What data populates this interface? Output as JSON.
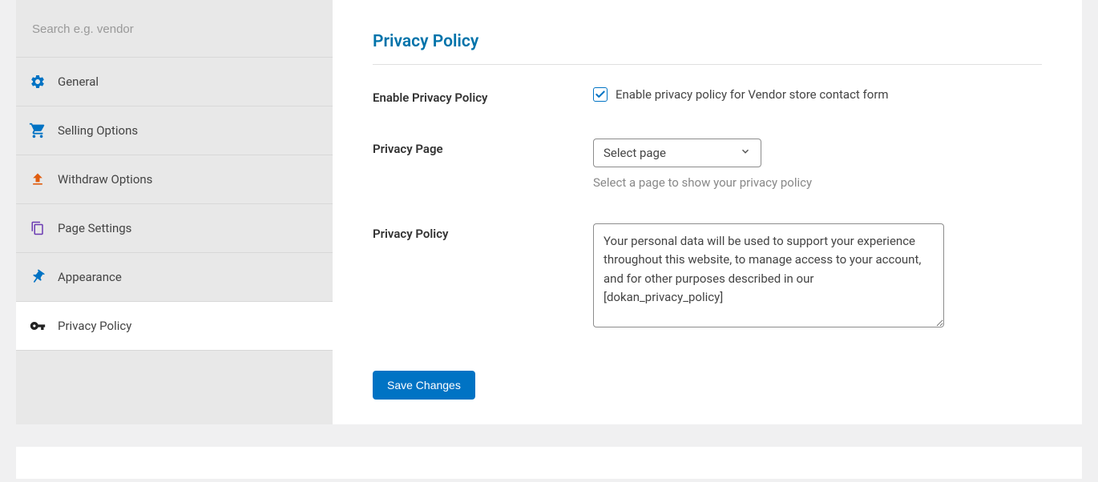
{
  "sidebar": {
    "search_placeholder": "Search e.g. vendor",
    "items": [
      {
        "label": "General"
      },
      {
        "label": "Selling Options"
      },
      {
        "label": "Withdraw Options"
      },
      {
        "label": "Page Settings"
      },
      {
        "label": "Appearance"
      },
      {
        "label": "Privacy Policy"
      }
    ]
  },
  "main": {
    "title": "Privacy Policy",
    "enable_label": "Enable Privacy Policy",
    "enable_checkbox_label": "Enable privacy policy for Vendor store contact form",
    "page_label": "Privacy Page",
    "page_select_value": "Select page",
    "page_help": "Select a page to show your privacy policy",
    "policy_label": "Privacy Policy",
    "policy_text": "Your personal data will be used to support your experience throughout this website, to manage access to your account, and for other purposes described in our [dokan_privacy_policy]",
    "save_button": "Save Changes"
  }
}
